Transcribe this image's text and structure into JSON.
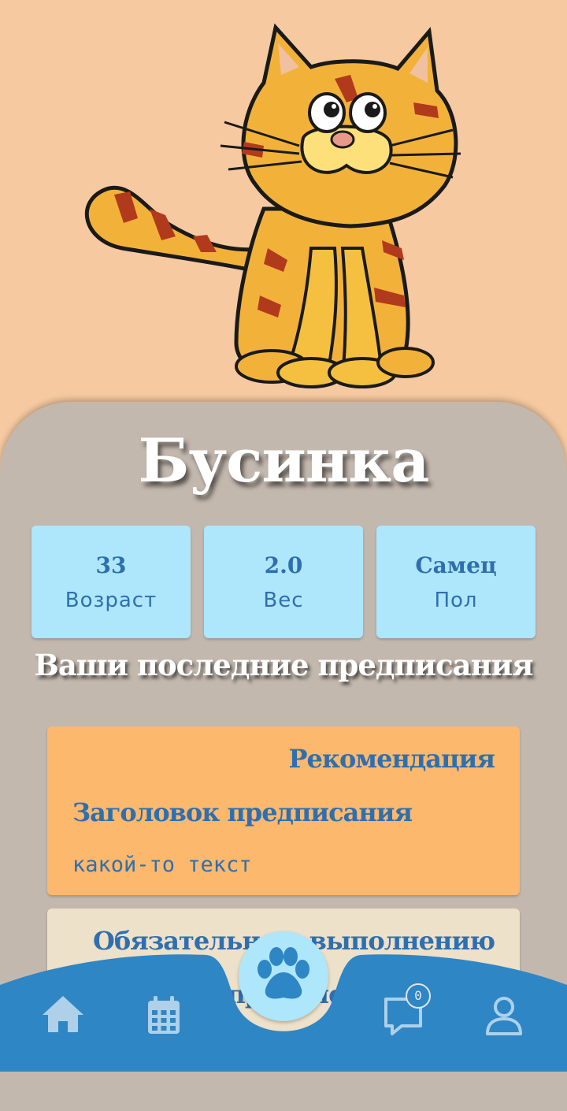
{
  "pet": {
    "name": "Бусинка",
    "stats": [
      {
        "value": "33",
        "label": "Возраст"
      },
      {
        "value": "2.0",
        "label": "Вес"
      },
      {
        "value": "Самец",
        "label": "Пол"
      }
    ]
  },
  "prescriptions": {
    "section_title": "Ваши последние предписания",
    "items": [
      {
        "type": "Рекомендация",
        "title": "Заголовок предписания",
        "text": "какой-то текст",
        "color": "#fcb86c"
      },
      {
        "type": "Обязательно к выполнению",
        "title": "Заголовок предписания",
        "text": "",
        "color": "#ede1c9"
      }
    ]
  },
  "nav": {
    "items": [
      {
        "icon": "home-icon"
      },
      {
        "icon": "calendar-icon"
      },
      {
        "icon": "paw-icon"
      },
      {
        "icon": "chat-icon"
      },
      {
        "icon": "user-icon"
      }
    ],
    "chat_badge": "0"
  },
  "colors": {
    "background": "#f6c9a0",
    "panel": "#c3b8ae",
    "stat_card": "#aee6fb",
    "accent_text": "#2f6fae",
    "nav_bar": "#2f86c5",
    "nav_icon": "#aed0e8"
  }
}
